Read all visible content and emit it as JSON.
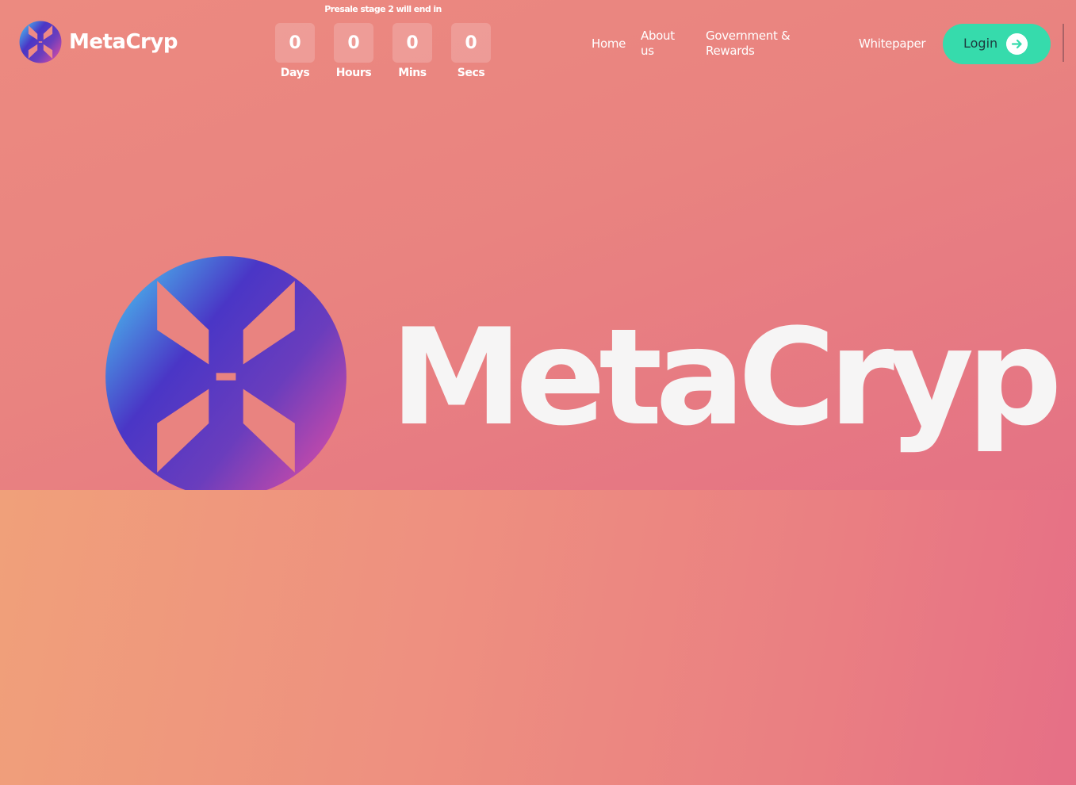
{
  "brand": {
    "name": "MetaCryp",
    "logo_icon": "metacryp-x-logo-icon"
  },
  "presale": {
    "text": "Presale stage 2 will end in",
    "countdown": [
      {
        "value": "0",
        "label": "Days"
      },
      {
        "value": "0",
        "label": "Hours"
      },
      {
        "value": "0",
        "label": "Mins"
      },
      {
        "value": "0",
        "label": "Secs"
      }
    ]
  },
  "nav": {
    "items": [
      {
        "label": "Home"
      },
      {
        "label": "About us"
      },
      {
        "label": "Government & Rewards"
      },
      {
        "label": "Whitepaper"
      }
    ]
  },
  "login": {
    "label": "Login",
    "icon": "arrow-right-icon"
  },
  "hero": {
    "wordmark": "MetaCryp",
    "logo_icon": "metacryp-x-logo-icon"
  },
  "colors": {
    "background_top": "#e98380",
    "background_bottom": "#f0a07a",
    "login_button": "#36dbac",
    "logo_gradient_start": "#4fc3f7",
    "logo_gradient_mid": "#4a3ac8",
    "logo_gradient_end": "#d64ba4"
  }
}
